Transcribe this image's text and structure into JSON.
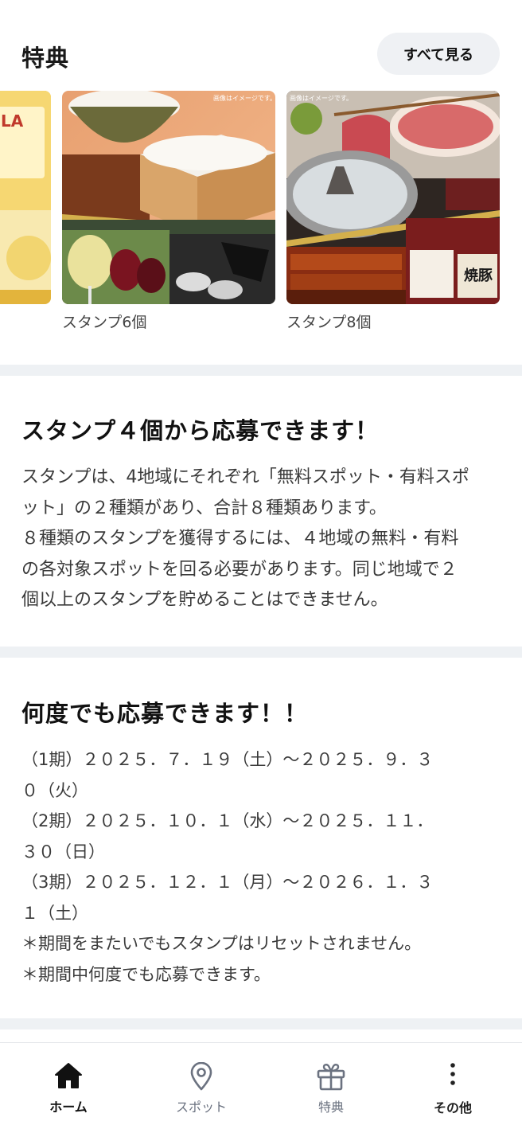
{
  "benefits": {
    "title": "特典",
    "see_all_label": "すべて見る",
    "cards": [
      {
        "caption": ""
      },
      {
        "caption": "スタンプ6個",
        "image_note": "画像はイメージです。"
      },
      {
        "caption": "スタンプ8個",
        "image_note": "画像はイメージです。",
        "badge": "焼豚"
      }
    ]
  },
  "section_apply": {
    "title": "スタンプ４個から応募できます！",
    "lines": [
      "スタンプは、4地域にそれぞれ「無料スポット・有料スポ",
      "ット」の２種類があり、合計８種類あります。",
      "８種類のスタンプを獲得するには、４地域の無料・有料",
      "の各対象スポットを回る必要があります。同じ地域で２",
      "個以上のスタンプを貯めることはできません。"
    ]
  },
  "section_periods": {
    "title": "何度でも応募できます！！",
    "lines": [
      "（1期）２０２５．７．１９（土）〜２０２５．９．３",
      "０（火）",
      "（2期）２０２５．１０．１（水）〜２０２５．１１．",
      "３０（日）",
      "（3期）２０２５．１２．１（月）〜２０２６．１．３",
      "１（土）",
      "＊期間をまたいでもスタンプはリセットされません。",
      "＊期間中何度でも応募できます。"
    ]
  },
  "nav": {
    "home": "ホーム",
    "spot": "スポット",
    "benefits": "特典",
    "other": "その他"
  },
  "colors": {
    "accent": "#111111",
    "inactive": "#6b7280",
    "separator": "#eef1f4",
    "button_bg": "#eff1f4"
  }
}
